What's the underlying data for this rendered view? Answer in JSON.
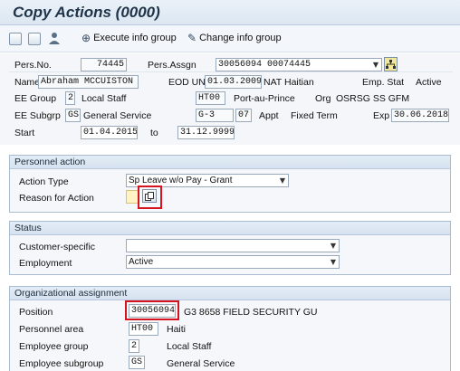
{
  "window": {
    "title": "Copy Actions (0000)"
  },
  "toolbar": {
    "icons": [
      "save-icon",
      "display-icon",
      "user-icon"
    ],
    "execute_info_group": "Execute info group",
    "change_info_group": "Change info group"
  },
  "header": {
    "pers_no_label": "Pers.No.",
    "pers_no": "74445",
    "pers_assgn_label": "Pers.Assgn",
    "pers_assgn": "30056094 00074445",
    "name_label": "Name",
    "name": "Abraham MCCUISTON",
    "eod_label": "EOD UN",
    "eod": "01.03.2009",
    "nat_label": "NAT",
    "nat": "Haitian",
    "emp_stat_label": "Emp. Stat",
    "emp_stat": "Active",
    "ee_group_label": "EE Group",
    "ee_group_code": "2",
    "ee_group": "Local Staff",
    "location_code": "HT00",
    "location": "Port-au-Prince",
    "org_label": "Org",
    "org": "OSRSG SS GFM",
    "ee_subgrp_label": "EE Subgrp",
    "ee_subgrp_code": "GS",
    "ee_subgrp": "General Service",
    "grade": "G-3",
    "step": "07",
    "appt_label": "Appt",
    "appt": "Fixed Term",
    "exp_label": "Exp",
    "exp": "30.06.2018",
    "start_label": "Start",
    "start": "01.04.2015",
    "to_label": "to",
    "end": "31.12.9999"
  },
  "personnel_action": {
    "title": "Personnel action",
    "action_type_label": "Action Type",
    "action_type": "Sp Leave w/o Pay - Grant",
    "reason_label": "Reason for Action",
    "reason_value": ""
  },
  "status": {
    "title": "Status",
    "customer_specific_label": "Customer-specific",
    "customer_specific": "",
    "employment_label": "Employment",
    "employment": "Active"
  },
  "org_assignment": {
    "title": "Organizational assignment",
    "position_label": "Position",
    "position": "30056094",
    "position_text": "G3 8658 FIELD SECURITY GU",
    "personnel_area_label": "Personnel area",
    "personnel_area": "HT00",
    "personnel_area_text": "Haiti",
    "employee_group_label": "Employee group",
    "employee_group": "2",
    "employee_group_text": "Local Staff",
    "employee_subgroup_label": "Employee subgroup",
    "employee_subgroup": "GS",
    "employee_subgroup_text": "General Service"
  },
  "colors": {
    "highlight": "#d6141f",
    "header_bg": "#dce7f2"
  }
}
